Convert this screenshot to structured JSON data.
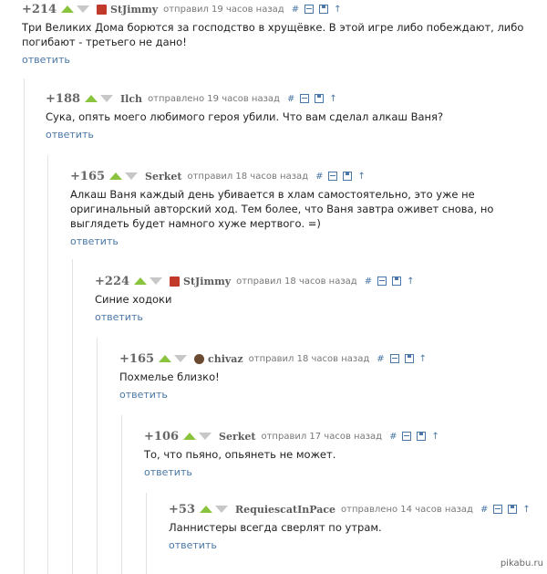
{
  "comments": [
    {
      "rating": "+214",
      "author": "StJimmy",
      "meta": "отправил 19 часов назад",
      "text": "Три Великих Дома борются за господство в хрущёвке. В этой игре либо побеждают, либо погибают - третьего не дано!",
      "reply": "ответить",
      "avatar": "red"
    },
    {
      "rating": "+188",
      "author": "Ilch",
      "meta": "отправлено 19 часов назад",
      "text": "Сука, опять моего любимого героя убили. Что вам сделал алкаш Ваня?",
      "reply": "ответить",
      "avatar": ""
    },
    {
      "rating": "+165",
      "author": "Serket",
      "meta": "отправил 18 часов назад",
      "text": "Алкаш Ваня каждый день убивается в хлам самостоятельно, это уже не оригинальный авторский ход. Тем более, что Ваня завтра оживет снова, но выглядеть будет намного хуже мертвого. =)",
      "reply": "ответить",
      "avatar": ""
    },
    {
      "rating": "+224",
      "author": "StJimmy",
      "meta": "отправил 18 часов назад",
      "text": "Синие ходоки",
      "reply": "ответить",
      "avatar": "red"
    },
    {
      "rating": "+165",
      "author": "chivaz",
      "meta": "отправил 18 часов назад",
      "text": "Похмелье близко!",
      "reply": "ответить",
      "avatar": "brown"
    },
    {
      "rating": "+106",
      "author": "Serket",
      "meta": "отправил 17 часов назад",
      "text": "То, что пьяно, опьянеть не может.",
      "reply": "ответить",
      "avatar": ""
    },
    {
      "rating": "+53",
      "author": "RequiescatInPace",
      "meta": "отправлено 14 часов назад",
      "text": "Ланнистеры всегда сверлят по утрам.",
      "reply": "ответить",
      "avatar": ""
    }
  ],
  "icons": {
    "hash": "#",
    "up": "↑"
  },
  "watermark": "pikabu.ru"
}
